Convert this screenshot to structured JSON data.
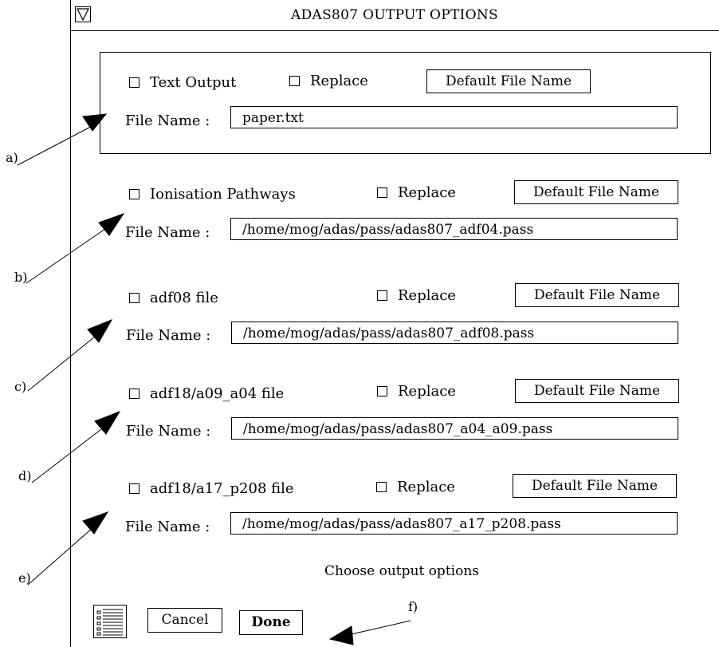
{
  "window": {
    "title": "ADAS807 OUTPUT OPTIONS",
    "menu_icon": "triangle-down-icon"
  },
  "sections": [
    {
      "id": "text",
      "label": "Text Output",
      "replace_label": "Replace",
      "default_label": "Default File Name",
      "file_label": "File Name :",
      "file_value": "paper.txt",
      "checked": false,
      "callout": "a)"
    },
    {
      "id": "ionisation",
      "label": "Ionisation Pathways",
      "replace_label": "Replace",
      "default_label": "Default File Name",
      "file_label": "File Name :",
      "file_value": "/home/mog/adas/pass/adas807_adf04.pass",
      "checked": false,
      "callout": "b)"
    },
    {
      "id": "adf08",
      "label": "adf08 file",
      "replace_label": "Replace",
      "default_label": "Default File Name",
      "file_label": "File Name :",
      "file_value": "/home/mog/adas/pass/adas807_adf08.pass",
      "checked": false,
      "callout": "c)"
    },
    {
      "id": "a09a04",
      "label": "adf18/a09_a04 file",
      "replace_label": "Replace",
      "default_label": "Default File Name",
      "file_label": "File Name :",
      "file_value": "/home/mog/adas/pass/adas807_a04_a09.pass",
      "checked": false,
      "callout": "d)"
    },
    {
      "id": "a17p208",
      "label": "adf18/a17_p208 file",
      "replace_label": "Replace",
      "default_label": "Default File Name",
      "file_label": "File Name :",
      "file_value": "/home/mog/adas/pass/adas807_a17_p208.pass",
      "checked": false,
      "callout": "e)"
    }
  ],
  "status": {
    "message": "Choose output options"
  },
  "footer": {
    "cancel_label": "Cancel",
    "done_label": "Done",
    "list_icon": "list-icon",
    "callout": "f)"
  }
}
